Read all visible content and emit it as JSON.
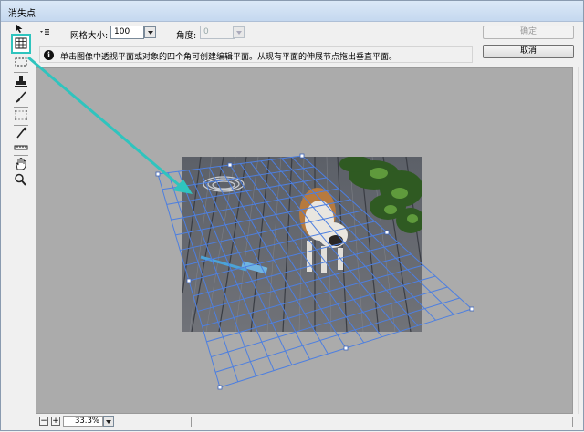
{
  "window": {
    "title": "消失点"
  },
  "toolbar": {
    "grid_size_label": "网格大小:",
    "grid_size_value": "100",
    "angle_label": "角度:",
    "angle_value": "0",
    "ok_label": "确定",
    "cancel_label": "取消"
  },
  "info": {
    "text": "单击图像中透视平面或对象的四个角可创建编辑平面。从现有平面的伸展节点拖出垂直平面。"
  },
  "tools": [
    {
      "name": "edit-plane-tool",
      "icon": "pointer-icon"
    },
    {
      "name": "create-plane-tool",
      "icon": "grid-plane-icon",
      "selected": true
    },
    {
      "name": "marquee-tool",
      "icon": "marquee-icon"
    },
    {
      "name": "stamp-tool",
      "icon": "stamp-icon"
    },
    {
      "name": "brush-tool",
      "icon": "brush-icon"
    },
    {
      "name": "transform-tool",
      "icon": "transform-icon"
    },
    {
      "name": "eyedropper-tool",
      "icon": "eyedropper-icon"
    },
    {
      "name": "measure-tool",
      "icon": "ruler-icon"
    },
    {
      "name": "hand-tool",
      "icon": "hand-icon"
    },
    {
      "name": "zoom-tool",
      "icon": "magnifier-icon"
    }
  ],
  "status": {
    "zoom_value": "33.3%"
  },
  "colors": {
    "accent": "#2fc4be",
    "grid": "#4d7fe0",
    "canvas": "#ababab"
  }
}
